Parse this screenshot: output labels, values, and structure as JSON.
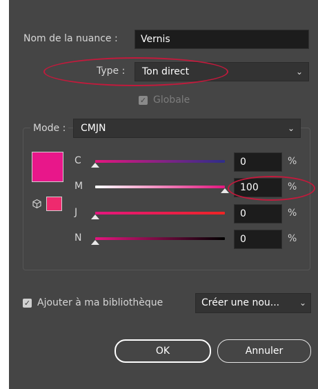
{
  "swatch": {
    "name_label": "Nom de la nuance :",
    "name_value": "Vernis",
    "type_label": "Type :",
    "type_value": "Ton direct",
    "global_label": "Globale",
    "global_checked": true,
    "global_enabled": false
  },
  "color_group": {
    "mode_label": "Mode :",
    "mode_value": "CMJN",
    "preview_color": "#e8178a",
    "gamut_swatch_color": "#ee2a6e",
    "channels": [
      {
        "label": "C",
        "value": "0",
        "unit": "%",
        "gradient": [
          "#e4167f",
          "#2e2e8a"
        ],
        "thumb_fraction": 0.0
      },
      {
        "label": "M",
        "value": "100",
        "unit": "%",
        "gradient": [
          "#ffffff",
          "#e4167f"
        ],
        "thumb_fraction": 1.0
      },
      {
        "label": "J",
        "value": "0",
        "unit": "%",
        "gradient": [
          "#e4167f",
          "#ee2424"
        ],
        "thumb_fraction": 0.0
      },
      {
        "label": "N",
        "value": "0",
        "unit": "%",
        "gradient": [
          "#e4167f",
          "#000000"
        ],
        "thumb_fraction": 0.0
      }
    ]
  },
  "library": {
    "add_label": "Ajouter à ma bibliothèque",
    "add_checked": true,
    "library_value": "Créer une nou..."
  },
  "buttons": {
    "ok": "OK",
    "cancel": "Annuler"
  },
  "colors": {
    "dialog_bg": "#454545",
    "annotation": "#c21a3c"
  }
}
